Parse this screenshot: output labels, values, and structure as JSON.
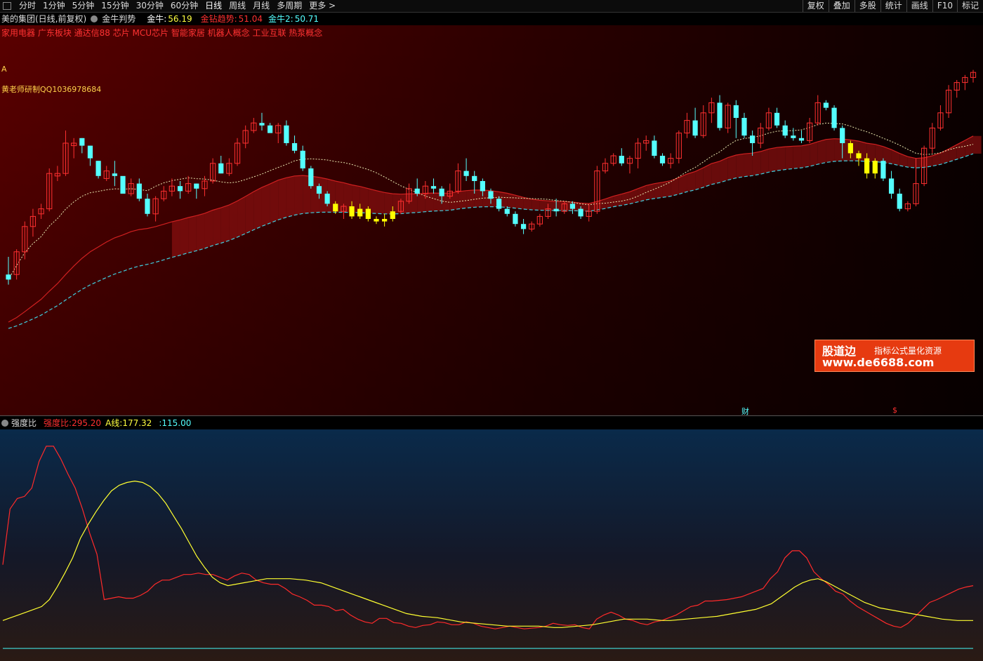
{
  "toolbar": {
    "tabs": [
      "分时",
      "1分钟",
      "5分钟",
      "15分钟",
      "30分钟",
      "60分钟",
      "日线",
      "周线",
      "月线",
      "多周期",
      "更多 >"
    ],
    "active_tab": 6,
    "right_tools": [
      "复权",
      "叠加",
      "多股",
      "统计",
      "画线",
      "F10",
      "标记"
    ]
  },
  "info": {
    "title": "美的集团(日线,前复权)",
    "indicator": "金牛判势",
    "v1_label": "金牛:",
    "v1_value": "56.19",
    "v2_label": "金钻趋势:",
    "v2_value": "51.04",
    "v3_label": "金牛2:",
    "v3_value": "50.71"
  },
  "concepts": "家用电器 广东板块 通达信88 芯片 MCU芯片 智能家居 机器人概念 工业互联 热泵概念",
  "label_a": "A",
  "author": "黄老师研制QQ1036978684",
  "watermark": {
    "line1": "股道边",
    "line2": "指标公式量化资源",
    "line3": "www.de6688.com"
  },
  "markers": {
    "cai": "财",
    "s": "$"
  },
  "sub": {
    "name": "强度比",
    "s1_label": "强度比:",
    "s1_value": "295.20",
    "s2_label": "A线:",
    "s2_value": "177.32",
    "s3_label": ":",
    "s3_value": "115.00"
  },
  "colors": {
    "up": "#ff3030",
    "down": "#54ffff",
    "warn": "#ffff00",
    "ma_white": "#e8e8b0",
    "ma_red": "#d02020",
    "ma_cyan": "#40d0e0",
    "band_green": "#0a7a1a",
    "band_red": "#8a1010"
  },
  "chart_data": [
    {
      "type": "candlestick",
      "price_range": [
        0,
        100
      ],
      "candles": [
        [
          18,
          16,
          14,
          25
        ],
        [
          18,
          27,
          16,
          28
        ],
        [
          27,
          37,
          24,
          39
        ],
        [
          37,
          41,
          33,
          44
        ],
        [
          42,
          44,
          40,
          46
        ],
        [
          44,
          58,
          43,
          60
        ],
        [
          57,
          58,
          55,
          61
        ],
        [
          58,
          70,
          57,
          75
        ],
        [
          69,
          70,
          64,
          72
        ],
        [
          72,
          69,
          66,
          72
        ],
        [
          69,
          64,
          61,
          69
        ],
        [
          63,
          57,
          56,
          63
        ],
        [
          56,
          59,
          55,
          61
        ],
        [
          58,
          57,
          53,
          63
        ],
        [
          57,
          50,
          50,
          54
        ],
        [
          50,
          54,
          49,
          56
        ],
        [
          54,
          48,
          47,
          56
        ],
        [
          48,
          42,
          41,
          50
        ],
        [
          42,
          48,
          39,
          49
        ],
        [
          48,
          51,
          47,
          53
        ],
        [
          51,
          53,
          49,
          56
        ],
        [
          53,
          51,
          48,
          55
        ],
        [
          51,
          54,
          50,
          57
        ],
        [
          54,
          52,
          48,
          54
        ],
        [
          52,
          55,
          49,
          57
        ],
        [
          55,
          62,
          54,
          64
        ],
        [
          62,
          58,
          58,
          65
        ],
        [
          58,
          62,
          57,
          64
        ],
        [
          62,
          70,
          61,
          72
        ],
        [
          70,
          75,
          68,
          77
        ],
        [
          75,
          78,
          74,
          80
        ],
        [
          78,
          77,
          75,
          82
        ],
        [
          77,
          74,
          74,
          78
        ],
        [
          74,
          77,
          70,
          78
        ],
        [
          77,
          70,
          69,
          79
        ],
        [
          70,
          67,
          66,
          73
        ],
        [
          67,
          60,
          59,
          69
        ],
        [
          60,
          53,
          52,
          61
        ],
        [
          53,
          50,
          48,
          54
        ],
        [
          50,
          46,
          45,
          51
        ],
        [
          46,
          43,
          42,
          47
        ],
        [
          43,
          45,
          40,
          46
        ],
        [
          45,
          41,
          40,
          47
        ],
        [
          41,
          44,
          40,
          46
        ],
        [
          44,
          40,
          39,
          45
        ],
        [
          40,
          39,
          38,
          41
        ],
        [
          39,
          40,
          37,
          42
        ],
        [
          40,
          43,
          39,
          45
        ],
        [
          43,
          47,
          42,
          48
        ],
        [
          47,
          52,
          46,
          54
        ],
        [
          52,
          50,
          49,
          56
        ],
        [
          50,
          53,
          48,
          55
        ],
        [
          53,
          52,
          50,
          56
        ],
        [
          52,
          49,
          46,
          53
        ],
        [
          49,
          51,
          48,
          54
        ],
        [
          51,
          59,
          50,
          62
        ],
        [
          59,
          57,
          55,
          64
        ],
        [
          57,
          55,
          50,
          59
        ],
        [
          55,
          51,
          49,
          56
        ],
        [
          51,
          48,
          46,
          52
        ],
        [
          48,
          44,
          43,
          49
        ],
        [
          44,
          42,
          41,
          45
        ],
        [
          42,
          38,
          37,
          43
        ],
        [
          38,
          36,
          34,
          40
        ],
        [
          36,
          38,
          35,
          39
        ],
        [
          38,
          41,
          37,
          42
        ],
        [
          41,
          44,
          40,
          46
        ],
        [
          44,
          43,
          41,
          48
        ],
        [
          43,
          46,
          42,
          47
        ],
        [
          46,
          44,
          42,
          47
        ],
        [
          44,
          41,
          40,
          45
        ],
        [
          41,
          43,
          39,
          46
        ],
        [
          43,
          59,
          42,
          61
        ],
        [
          59,
          62,
          58,
          64
        ],
        [
          62,
          65,
          61,
          66
        ],
        [
          65,
          62,
          61,
          68
        ],
        [
          62,
          64,
          58,
          65
        ],
        [
          64,
          70,
          60,
          72
        ],
        [
          70,
          71,
          67,
          73
        ],
        [
          71,
          65,
          64,
          73
        ],
        [
          65,
          62,
          61,
          66
        ],
        [
          62,
          64,
          60,
          66
        ],
        [
          64,
          74,
          62,
          75
        ],
        [
          74,
          79,
          72,
          82
        ],
        [
          79,
          73,
          72,
          84
        ],
        [
          73,
          82,
          72,
          85
        ],
        [
          82,
          86,
          78,
          88
        ],
        [
          86,
          76,
          75,
          89
        ],
        [
          76,
          85,
          74,
          86
        ],
        [
          85,
          80,
          72,
          87
        ],
        [
          80,
          73,
          72,
          82
        ],
        [
          73,
          70,
          65,
          75
        ],
        [
          70,
          76,
          68,
          78
        ],
        [
          76,
          82,
          75,
          84
        ],
        [
          82,
          77,
          76,
          84
        ],
        [
          77,
          73,
          72,
          79
        ],
        [
          73,
          72,
          71,
          76
        ],
        [
          72,
          71,
          70,
          75
        ],
        [
          71,
          78,
          70,
          80
        ],
        [
          78,
          86,
          77,
          89
        ],
        [
          86,
          84,
          83,
          87
        ],
        [
          84,
          76,
          75,
          85
        ],
        [
          76,
          70,
          64,
          77
        ],
        [
          70,
          66,
          64,
          71
        ],
        [
          66,
          64,
          61,
          67
        ],
        [
          64,
          58,
          56,
          66
        ],
        [
          58,
          63,
          56,
          64
        ],
        [
          63,
          56,
          55,
          64
        ],
        [
          56,
          50,
          48,
          59
        ],
        [
          50,
          44,
          43,
          52
        ],
        [
          44,
          46,
          43,
          47
        ],
        [
          46,
          54,
          45,
          64
        ],
        [
          54,
          68,
          53,
          69
        ],
        [
          68,
          76,
          66,
          78
        ],
        [
          76,
          82,
          75,
          85
        ],
        [
          82,
          91,
          80,
          93
        ],
        [
          91,
          94,
          88,
          95
        ],
        [
          94,
          96,
          91,
          97
        ],
        [
          96,
          98,
          94,
          99
        ]
      ]
    },
    {
      "type": "line",
      "y_range": [
        0,
        320
      ],
      "series": [
        {
          "name": "强度比",
          "values": [
            130,
            210,
            225,
            228,
            240,
            278,
            300,
            300,
            282,
            260,
            240,
            210,
            175,
            145,
            80,
            82,
            84,
            82,
            82,
            86,
            92,
            102,
            108,
            108,
            112,
            116,
            116,
            118,
            116,
            116,
            112,
            108,
            114,
            118,
            116,
            108,
            104,
            102,
            102,
            96,
            88,
            84,
            79,
            72,
            72,
            70,
            64,
            66,
            58,
            52,
            48,
            46,
            53,
            53,
            47,
            46,
            42,
            40,
            43,
            44,
            48,
            47,
            44,
            44,
            48,
            46,
            42,
            40,
            38,
            40,
            42,
            40,
            38,
            39,
            40,
            42,
            46,
            44,
            43,
            44,
            40,
            38,
            52,
            58,
            62,
            58,
            52,
            50,
            46,
            44,
            48,
            50,
            54,
            58,
            64,
            70,
            72,
            78,
            78,
            79,
            80,
            82,
            84,
            88,
            92,
            96,
            110,
            120,
            140,
            150,
            150,
            140,
            120,
            110,
            102,
            92,
            88,
            78,
            70,
            64,
            58,
            52,
            46,
            42,
            40,
            46,
            56,
            66,
            76,
            80,
            85,
            90,
            95,
            98,
            100
          ]
        },
        {
          "name": "A线",
          "values": [
            50,
            54,
            58,
            62,
            66,
            70,
            80,
            98,
            118,
            140,
            168,
            188,
            206,
            222,
            236,
            244,
            248,
            250,
            248,
            242,
            232,
            218,
            200,
            182,
            162,
            142,
            126,
            112,
            104,
            100,
            102,
            104,
            106,
            108,
            110,
            110,
            110,
            110,
            109,
            108,
            106,
            104,
            100,
            96,
            92,
            88,
            84,
            80,
            76,
            72,
            68,
            64,
            60,
            58,
            56,
            55,
            54,
            52,
            50,
            48,
            47,
            46,
            45,
            44,
            43,
            42,
            42,
            42,
            42,
            42,
            41,
            40,
            40,
            41,
            42,
            43,
            44,
            46,
            48,
            50,
            52,
            52,
            52,
            52,
            51,
            50,
            50,
            51,
            52,
            53,
            54,
            55,
            56,
            58,
            60,
            62,
            64,
            66,
            70,
            74,
            82,
            90,
            98,
            104,
            108,
            110,
            106,
            100,
            94,
            88,
            82,
            76,
            72,
            68,
            66,
            64,
            62,
            60,
            58,
            56,
            54,
            52,
            51,
            50,
            50,
            50
          ]
        },
        {
          "name": "",
          "values": [
            10,
            10,
            10
          ]
        }
      ]
    }
  ]
}
